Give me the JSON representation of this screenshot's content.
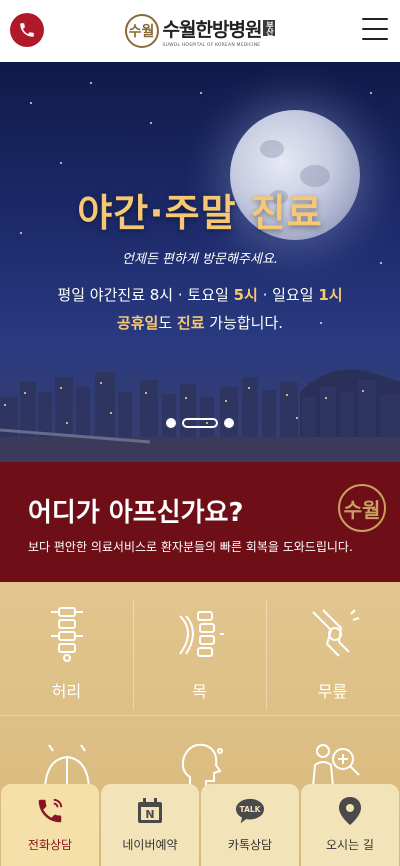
{
  "header": {
    "logo_mark": "수월",
    "logo_name": "수월한방병원",
    "logo_tag": "부산",
    "logo_sub": "SUWOL HOSPITAL OF KOREAN MEDICINE"
  },
  "hero": {
    "title": "야간·주말 진료",
    "subtitle": "언제든 편하게 방문해주세요.",
    "line1_pre": "평일 야간진료 8시 · 토요일 ",
    "line1_sat": "5시",
    "line1_mid": " · 일요일 ",
    "line1_sun": "1시",
    "line2_holiday": "공휴일",
    "line2_mid": "도 ",
    "line2_care": "진료",
    "line2_post": " 가능합니다."
  },
  "pain": {
    "title": "어디가 아프신가요?",
    "desc": "보다 편안한 의료서비스로 환자분들의 빠른 회복을 도와드립니다.",
    "logo_mark": "수월"
  },
  "parts": [
    {
      "label": "허리",
      "icon": "spine-icon"
    },
    {
      "label": "목",
      "icon": "neck-icon"
    },
    {
      "label": "무릎",
      "icon": "knee-icon"
    },
    {
      "label": "",
      "icon": "shoulder-icon"
    },
    {
      "label": "",
      "icon": "head-icon"
    },
    {
      "label": "",
      "icon": "body-search-icon"
    }
  ],
  "bottom_nav": [
    {
      "label": "전화상담",
      "icon": "phone-icon"
    },
    {
      "label": "네이버예약",
      "icon": "naver-calendar-icon"
    },
    {
      "label": "카톡상담",
      "icon": "kakaotalk-icon"
    },
    {
      "label": "오시는 길",
      "icon": "location-pin-icon"
    }
  ],
  "colors": {
    "brand_red": "#b0192a",
    "pain_bg": "#6e0f18",
    "gold": "#f7c873",
    "parts_bg": "#dcc085"
  }
}
